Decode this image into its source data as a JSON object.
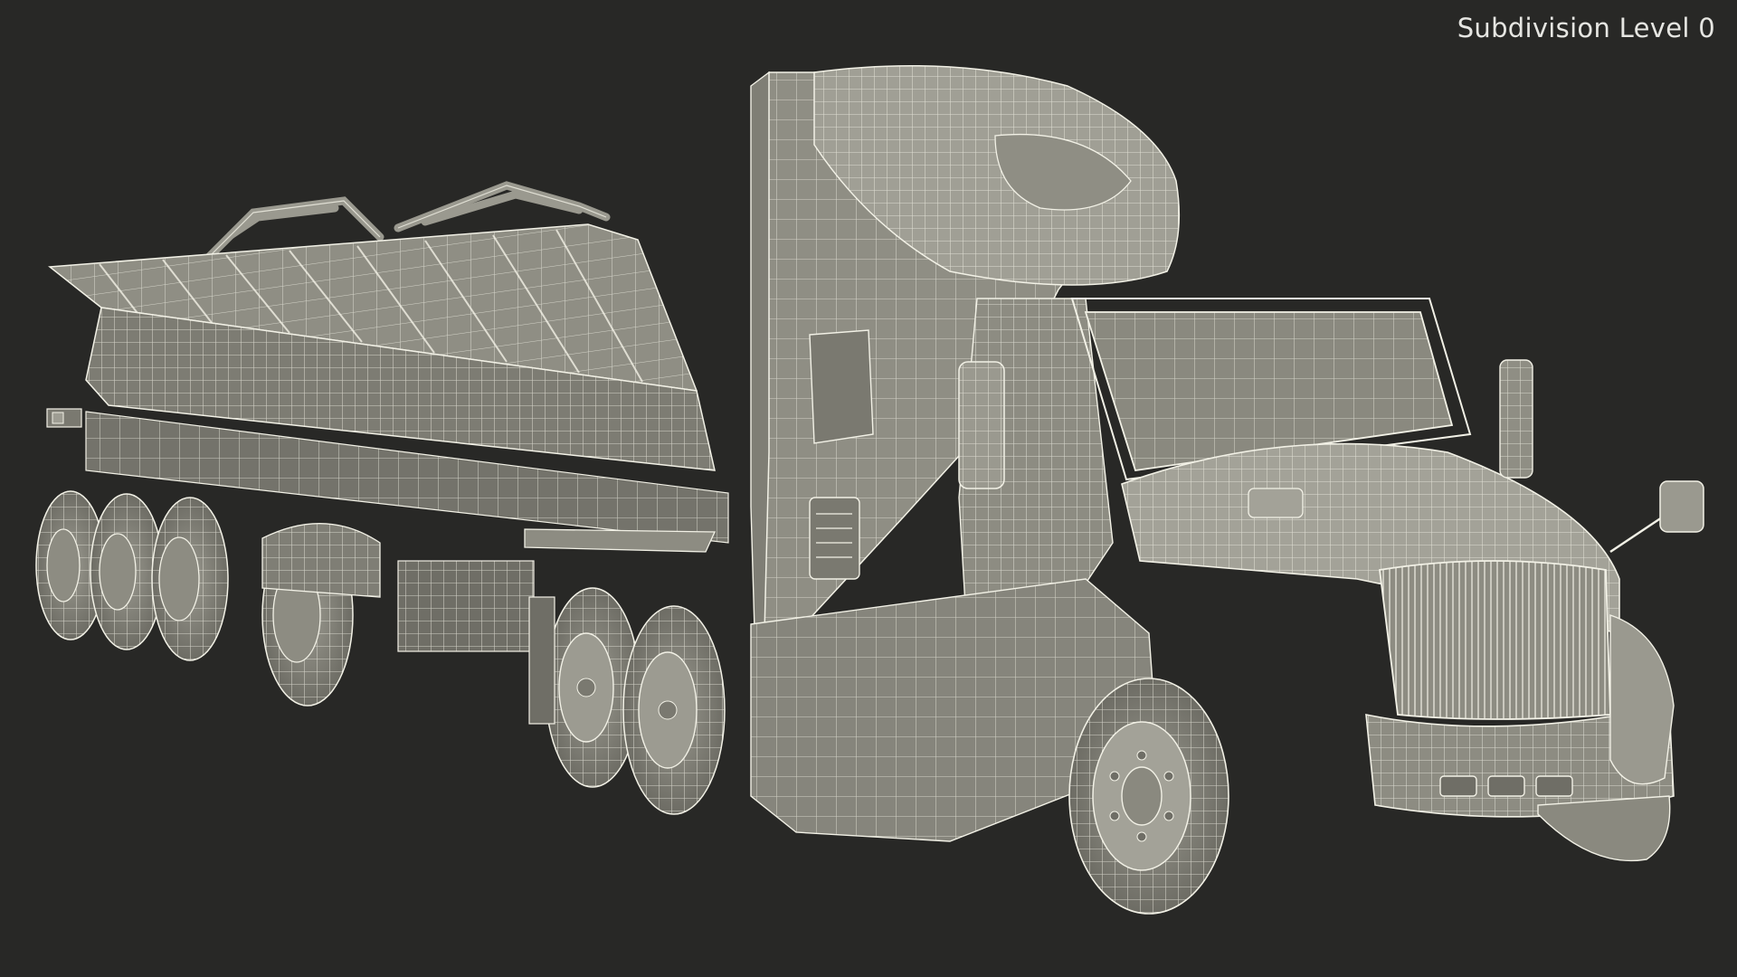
{
  "viewport": {
    "label": "Subdivision Level 0"
  },
  "colors": {
    "background": "#282826",
    "surface": "#8d8c82",
    "surface_light": "#a9a89e",
    "surface_dark": "#6f6e66",
    "wire": "#f2f1e6",
    "label": "#e6e6e2"
  }
}
